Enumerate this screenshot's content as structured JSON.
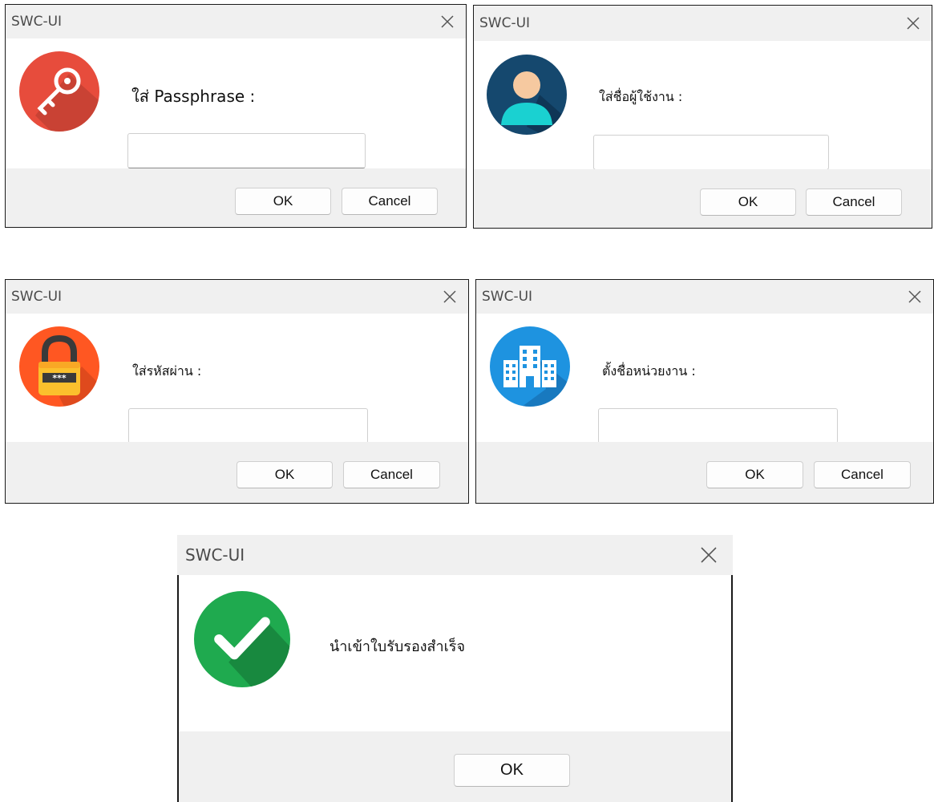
{
  "dialogs": [
    {
      "title": "SWC-UI",
      "icon": "key-icon",
      "prompt": "ใส่ Passphrase :",
      "input_value": "",
      "ok_label": "OK",
      "cancel_label": "Cancel"
    },
    {
      "title": "SWC-UI",
      "icon": "user-icon",
      "prompt": "ใส่ชื่อผู้ใช้งาน :",
      "input_value": "",
      "ok_label": "OK",
      "cancel_label": "Cancel"
    },
    {
      "title": "SWC-UI",
      "icon": "padlock-icon",
      "prompt": "ใส่รหัสผ่าน :",
      "input_value": "",
      "ok_label": "OK",
      "cancel_label": "Cancel"
    },
    {
      "title": "SWC-UI",
      "icon": "building-icon",
      "prompt": "ตั้งชื่อหน่วยงาน :",
      "input_value": "",
      "ok_label": "OK",
      "cancel_label": "Cancel"
    },
    {
      "title": "SWC-UI",
      "icon": "checkmark-icon",
      "message": "นำเข้าใบรับรองสำเร็จ",
      "ok_label": "OK"
    }
  ],
  "colors": {
    "titlebar": "#f0f0f0",
    "footer": "#f0f0f0",
    "key": "#e74c3c",
    "user": "#15486e",
    "padlock": "#ff5722",
    "building": "#1e93e0",
    "check": "#1faa4f"
  }
}
